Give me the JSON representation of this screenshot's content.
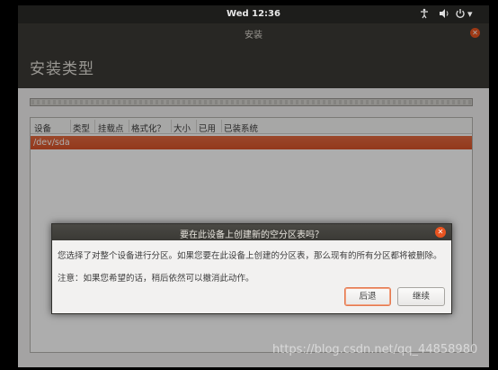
{
  "topbar": {
    "clock": "Wed 12:36",
    "accessibility_icon": "accessibility-icon",
    "volume_icon": "volume-icon",
    "power_icon": "power-icon",
    "menu_arrow": "▾"
  },
  "window": {
    "title": "安装",
    "close_glyph": "✕",
    "page_title": "安装类型"
  },
  "partition_table": {
    "columns": [
      "设备",
      "类型",
      "挂载点",
      "格式化？",
      "大小",
      "已用",
      "已装系统"
    ],
    "rows": [
      {
        "device": "/dev/sda"
      }
    ]
  },
  "dialog": {
    "title": "要在此设备上创建新的空分区表吗？",
    "close_glyph": "✕",
    "message": "您选择了对整个设备进行分区。如果您要在此设备上创建的分区表，那么现有的所有分区都将被删除。",
    "note": "注意：如果您希望的话，稍后依然可以撤消此动作。",
    "back_label": "后退",
    "continue_label": "继续"
  },
  "watermark": "https://blog.csdn.net/qq_44858980",
  "colors": {
    "accent": "#e95420",
    "titlebar": "#3b3a36",
    "window_bg": "#f2f1f0"
  }
}
